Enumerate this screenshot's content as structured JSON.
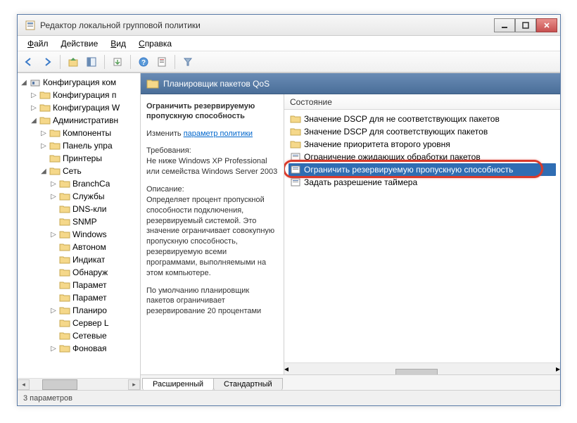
{
  "window": {
    "title": "Редактор локальной групповой политики"
  },
  "menubar": {
    "file": "Файл",
    "action": "Действие",
    "view": "Вид",
    "help": "Справка"
  },
  "tree": {
    "root": "Конфигурация ком",
    "n1": "Конфигурация п",
    "n2": "Конфигурация W",
    "n3": "Административн",
    "n3a": "Компоненты",
    "n3b": "Панель упра",
    "n3c": "Принтеры",
    "n3d": "Сеть",
    "net": {
      "a": "BranchCa",
      "b": "Службы",
      "c": "DNS-кли",
      "d": "SNMP",
      "e": "Windows",
      "f": "Автоном",
      "g": "Индикат",
      "h": "Обнаруж",
      "i": "Парамет",
      "j": "Парамет",
      "k": "Планиро",
      "l": "Сервер L",
      "m": "Сетевые",
      "n": "Фоновая"
    }
  },
  "detail": {
    "header": "Планировщик пакетов QoS",
    "title": "Ограничить резервируемую пропускную способность",
    "change_label": "Изменить",
    "link": "параметр политики",
    "req_label": "Требования:",
    "req_body": "Не ниже Windows XP Professional или семейства Windows Server 2003",
    "desc_label": "Описание:",
    "desc_body": "Определяет процент пропускной способности подключения, резервируемый системой. Это значение ограничивает совокупную пропускную способность, резервируемую всеми программами, выполняемыми на этом компьютере.",
    "desc_body2": "По умолчанию планировщик пакетов ограничивает резервирование 20 процентами"
  },
  "list": {
    "header": "Состояние",
    "items": [
      "Значение DSCP для не соответствующих пакетов",
      "Значение DSCP для соответствующих пакетов",
      "Значение приоритета второго уровня",
      "Ограничение ожидающих обработки пакетов",
      "Ограничить резервируемую пропускную способность",
      "Задать разрешение таймера"
    ]
  },
  "tabs": {
    "extended": "Расширенный",
    "standard": "Стандартный"
  },
  "status": "3 параметров"
}
